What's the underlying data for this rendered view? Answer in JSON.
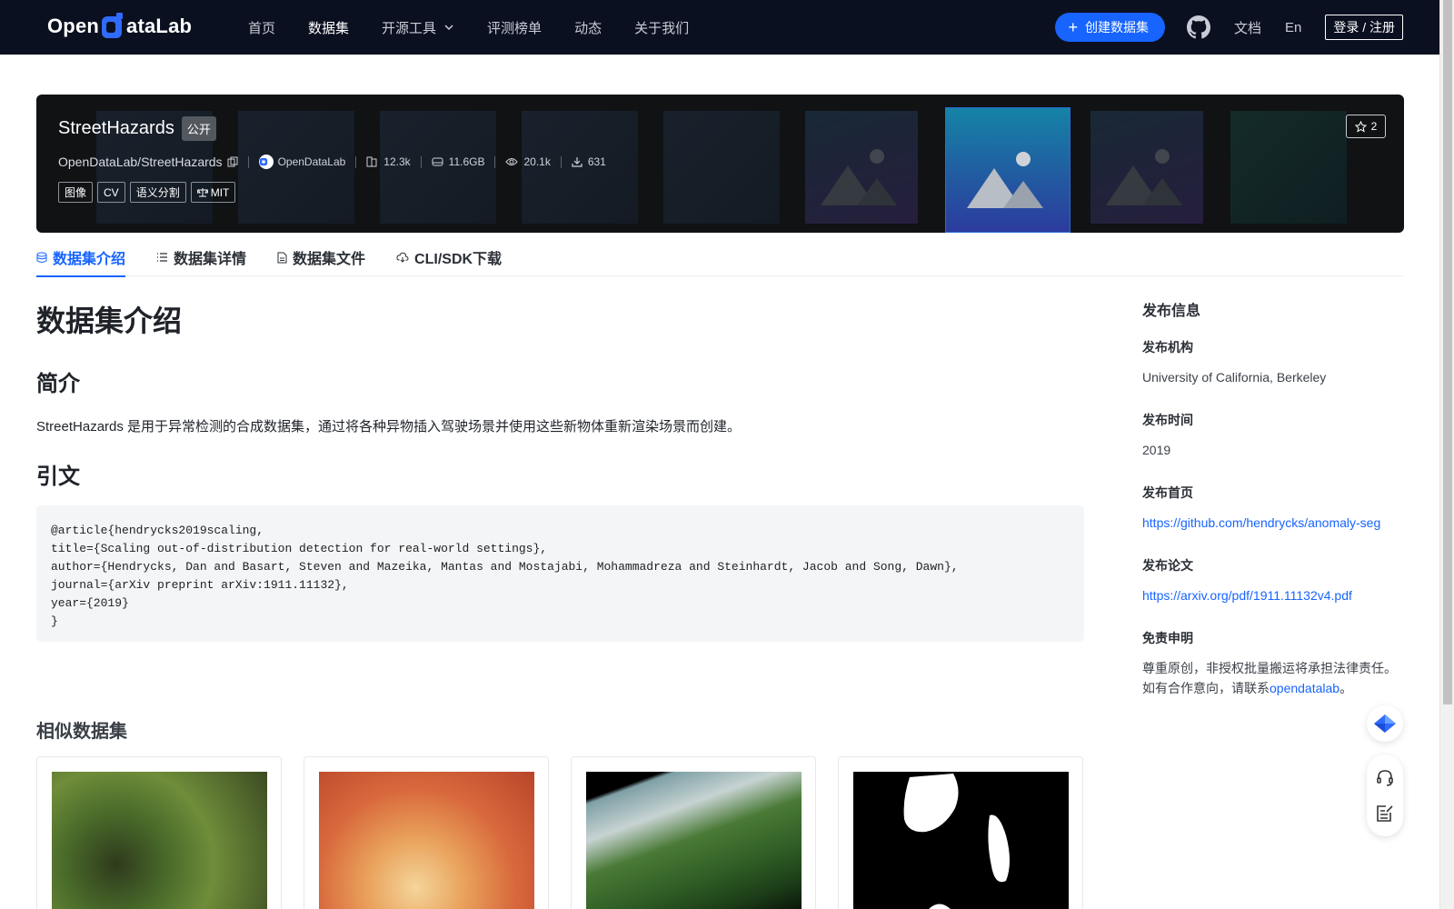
{
  "nav": {
    "logo_left": "Open",
    "logo_right": "ataLab",
    "items": [
      {
        "label": "首页"
      },
      {
        "label": "数据集"
      },
      {
        "label": "开源工具"
      },
      {
        "label": "评测榜单"
      },
      {
        "label": "动态"
      },
      {
        "label": "关于我们"
      }
    ],
    "create_label": "创建数据集",
    "docs_label": "文档",
    "lang_label": "En",
    "login_label": "登录 / 注册"
  },
  "dataset": {
    "title": "StreetHazards",
    "visibility": "公开",
    "repo": "OpenDataLab/StreetHazards",
    "org": "OpenDataLab",
    "size_count": "12.3k",
    "storage": "11.6GB",
    "views": "20.1k",
    "downloads": "631",
    "tags": [
      "图像",
      "CV",
      "语义分割",
      "MIT"
    ],
    "stars": "2"
  },
  "tabs": [
    {
      "label": "数据集介绍"
    },
    {
      "label": "数据集详情"
    },
    {
      "label": "数据集文件"
    },
    {
      "label": "CLI/SDK下载"
    }
  ],
  "content": {
    "heading": "数据集介绍",
    "intro_heading": "简介",
    "intro_text": "StreetHazards 是用于异常检测的合成数据集，通过将各种异物插入驾驶场景并使用这些新物体重新渲染场景而创建。",
    "citation_heading": "引文",
    "citation": "@article{hendrycks2019scaling,\ntitle={Scaling out-of-distribution detection for real-world settings},\nauthor={Hendrycks, Dan and Basart, Steven and Mazeika, Mantas and Mostajabi, Mohammadreza and Steinhardt, Jacob and Song, Dawn},\njournal={arXiv preprint arXiv:1911.11132},\nyear={2019}\n}"
  },
  "similar": {
    "title": "相似数据集"
  },
  "sidebar": {
    "title": "发布信息",
    "org_label": "发布机构",
    "org_value": "University of California, Berkeley",
    "time_label": "发布时间",
    "time_value": "2019",
    "home_label": "发布首页",
    "home_value": "https://github.com/hendrycks/anomaly-seg",
    "paper_label": "发布论文",
    "paper_value": "https://arxiv.org/pdf/1911.11132v4.pdf",
    "disclaimer_label": "免责申明",
    "disclaimer_line1": "尊重原创，非授权批量搬运将承担法律责任。",
    "disclaimer_line2_prefix": "如有合作意向，请联系",
    "disclaimer_link": "opendatalab",
    "disclaimer_suffix": "。"
  },
  "colors": {
    "accent": "#1764ff",
    "nav_bg": "#0b1020",
    "banner_bg": "#101214"
  }
}
